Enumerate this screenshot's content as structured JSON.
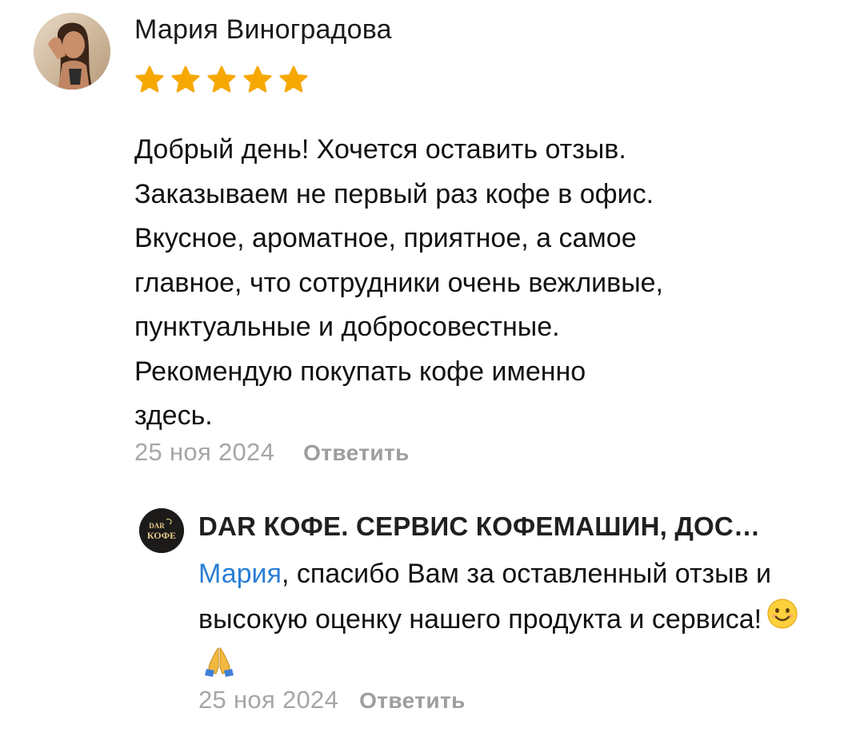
{
  "review": {
    "author": "Мария Виноградова",
    "rating": 5,
    "rating_max": 5,
    "star_color": "#f7a800",
    "text": "Добрый день! Хочется оставить отзыв.\nЗаказываем не первый раз кофе в офис.\nВкусное, ароматное, приятное, а самое\nглавное, что сотрудники очень вежливые,\nпунктуальные и добросовестные.\nРекомендую покупать кофе именно\nздесь.",
    "date": "25 ноя 2024",
    "reply_label": "Ответить"
  },
  "reply": {
    "author": "DAR КОФЕ. СЕРВИС КОФЕМАШИН, ДОС…",
    "logo_text_top": "DAR",
    "logo_text_bottom": "КОФЕ",
    "mention": "Мария",
    "text": ", спасибо Вам за оставленный отзыв и высокую оценку нашего продукта и сервиса!",
    "emojis": [
      "smiling-face-emoji",
      "folded-hands-emoji"
    ],
    "date": "25 ноя 2024",
    "reply_label": "Ответить"
  },
  "colors": {
    "mention": "#2a7fd4",
    "meta_text": "#a6a6a6"
  }
}
